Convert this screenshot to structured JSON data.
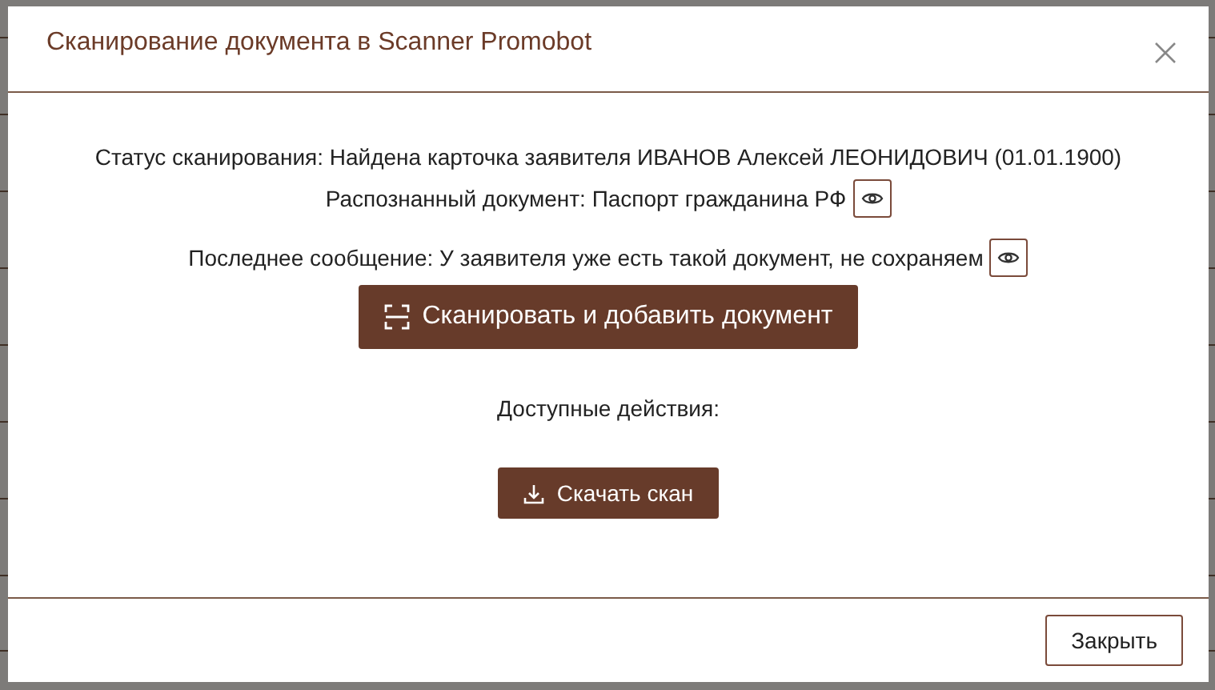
{
  "dialog": {
    "title": "Сканирование документа в Scanner Promobot",
    "status_line": "Статус сканирования: Найдена карточка заявителя ИВАНОВ Алексей ЛЕОНИДОВИЧ (01.01.1900)",
    "recognized_line": "Распознанный документ: Паспорт гражданина РФ",
    "message_line": "Последнее сообщение: У заявителя уже есть такой документ, не сохраняем",
    "scan_button": "Сканировать и добавить документ",
    "actions_label": "Доступные действия:",
    "download_button": "Скачать скан",
    "close_button": "Закрыть"
  }
}
